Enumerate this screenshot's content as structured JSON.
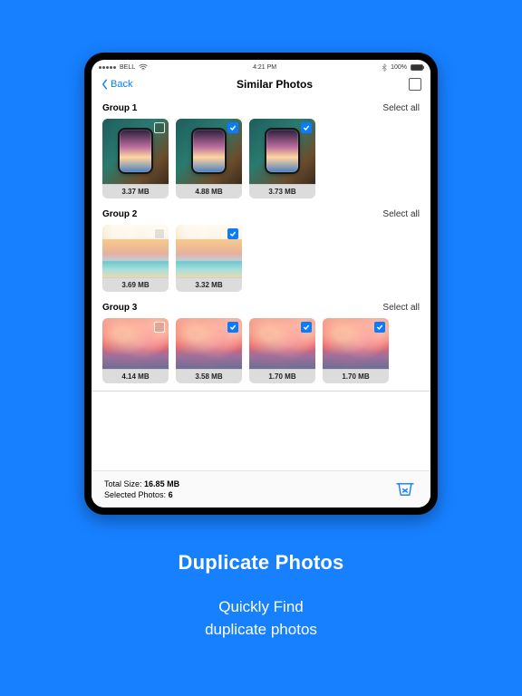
{
  "statusBar": {
    "carrier": "BELL",
    "time": "4:21 PM",
    "batteryText": "100%"
  },
  "nav": {
    "back": "Back",
    "title": "Similar Photos"
  },
  "labels": {
    "selectAll": "Select all",
    "totalSizeLabel": "Total Size:",
    "selectedPhotosLabel": "Selected Photos:"
  },
  "summary": {
    "totalSize": "16.85 MB",
    "selectedCount": "6"
  },
  "groups": [
    {
      "name": "Group 1",
      "kind": "phone",
      "photos": [
        {
          "size": "3.37 MB",
          "selected": false
        },
        {
          "size": "4.88 MB",
          "selected": true
        },
        {
          "size": "3.73 MB",
          "selected": true
        }
      ]
    },
    {
      "name": "Group 2",
      "kind": "beach",
      "photos": [
        {
          "size": "3.69 MB",
          "selected": false
        },
        {
          "size": "3.32 MB",
          "selected": true
        }
      ]
    },
    {
      "name": "Group 3",
      "kind": "clouds",
      "photos": [
        {
          "size": "4.14 MB",
          "selected": false
        },
        {
          "size": "3.58 MB",
          "selected": true
        },
        {
          "size": "1.70 MB",
          "selected": true
        },
        {
          "size": "1.70 MB",
          "selected": true
        }
      ]
    }
  ],
  "marketing": {
    "headline": "Duplicate Photos",
    "sub1": "Quickly Find",
    "sub2": "duplicate photos"
  }
}
